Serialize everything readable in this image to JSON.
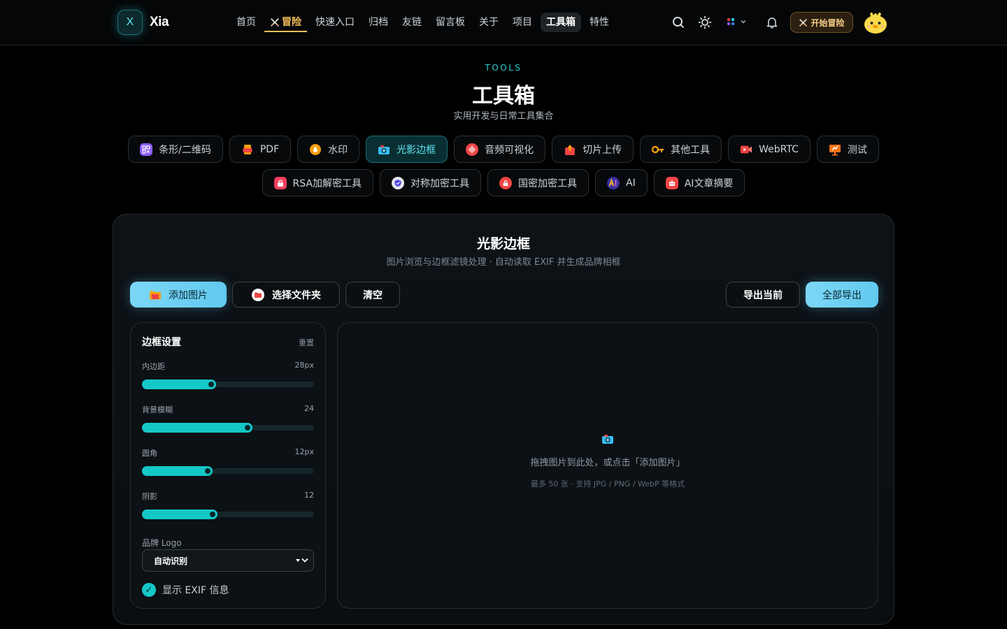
{
  "header": {
    "logo_letter": "X",
    "logo_text": "Xia",
    "nav": [
      {
        "label": "首页"
      },
      {
        "label": "冒险",
        "icon": "crossed-swords-icon"
      },
      {
        "label": "快速入口"
      },
      {
        "label": "归档"
      },
      {
        "label": "友链"
      },
      {
        "label": "留言板"
      },
      {
        "label": "关于"
      },
      {
        "label": "项目"
      },
      {
        "label": "工具箱",
        "active": true
      },
      {
        "label": "特性"
      }
    ],
    "start_button": "开始冒险",
    "accent_color": "#22d3ee",
    "adventure_color": "#f7c15b"
  },
  "hero": {
    "eyebrow": "TOOLS",
    "title": "工具箱",
    "subtitle": "实用开发与日常工具集合"
  },
  "tools_row1": [
    {
      "label": "条形/二维码",
      "icon": "qrcode-icon",
      "color": "#8b5cf6"
    },
    {
      "label": "PDF",
      "icon": "pdf-icon",
      "color": "#ef4444"
    },
    {
      "label": "水印",
      "icon": "watermark-icon",
      "color": "#f59e0b"
    },
    {
      "label": "光影边框",
      "icon": "camera-icon",
      "color": "#22d3ee",
      "active": true
    },
    {
      "label": "音频可视化",
      "icon": "audio-icon",
      "color": "#ef4444"
    },
    {
      "label": "切片上传",
      "icon": "upload-icon",
      "color": "#ef4444"
    },
    {
      "label": "其他工具",
      "icon": "tools-icon",
      "color": "#f59e0b"
    },
    {
      "label": "WebRTC",
      "icon": "video-icon",
      "color": "#ef4444"
    },
    {
      "label": "测试",
      "icon": "test-icon",
      "color": "#f97316"
    }
  ],
  "tools_row2": [
    {
      "label": "RSA加解密工具",
      "icon": "lock-icon",
      "color": "#f43f5e"
    },
    {
      "label": "对称加密工具",
      "icon": "shield-icon",
      "color": "#6366f1"
    },
    {
      "label": "国密加密工具",
      "icon": "lock-icon",
      "color": "#ef4444"
    },
    {
      "label": "AI",
      "icon": "ai-icon",
      "color": "#4f46e5"
    },
    {
      "label": "AI文章摘要",
      "icon": "robot-icon",
      "color": "#ef4444"
    }
  ],
  "panel": {
    "title": "光影边框",
    "subtitle": "图片浏览与边框滤镜处理 · 自动读取 EXIF 并生成品牌相框",
    "add_image": "添加图片",
    "select_folder": "选择文件夹",
    "clear": "清空",
    "export_current": "导出当前",
    "export_all": "全部导出"
  },
  "settings": {
    "title": "边框设置",
    "reset": "重置",
    "sliders": [
      {
        "label": "内边距",
        "value": "28px",
        "fraction": 0.39
      },
      {
        "label": "背景模糊",
        "value": "24",
        "fraction": 0.6
      },
      {
        "label": "圆角",
        "value": "12px",
        "fraction": 0.37
      },
      {
        "label": "阴影",
        "value": "12",
        "fraction": 0.4
      }
    ],
    "logo_label": "品牌 Logo",
    "logo_selected": "自动识别",
    "exif_label": "显示 EXIF 信息",
    "exif_checked": true
  },
  "dropzone": {
    "icon": "camera-icon",
    "text": "拖拽图片到此处，或点击「添加图片」",
    "subtext": "最多 50 张 · 支持 JPG / PNG / WebP 等格式"
  }
}
